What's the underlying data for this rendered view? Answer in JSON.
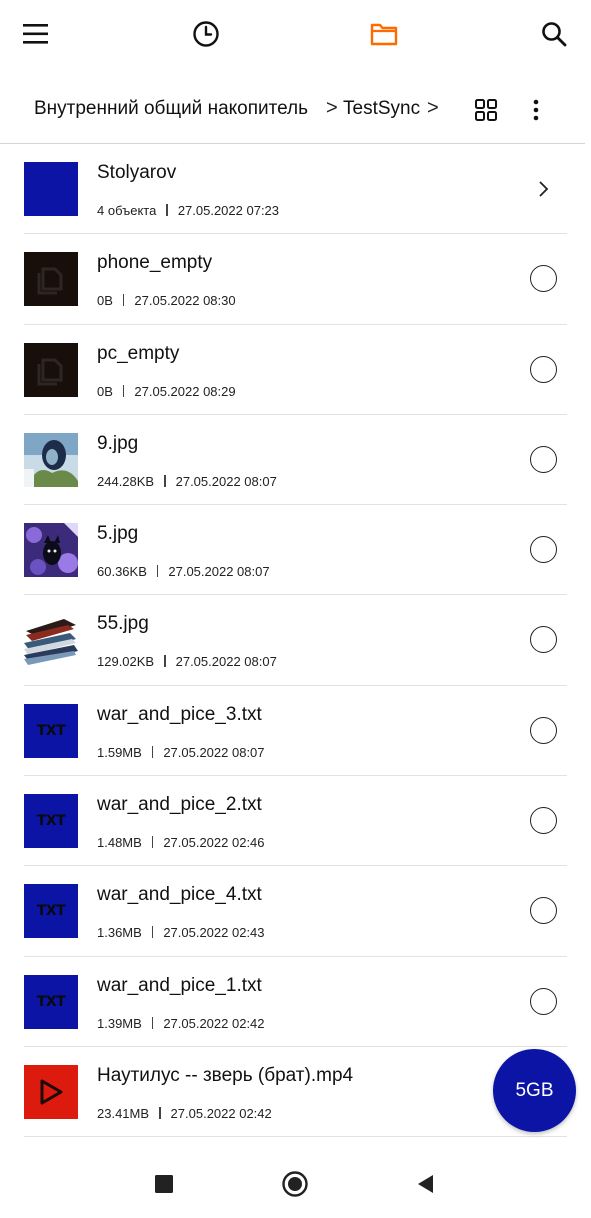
{
  "toolbar": {
    "icons": [
      "menu-icon",
      "clock-icon",
      "folder-icon",
      "search-icon"
    ],
    "accent_color": "#ff6a00"
  },
  "path": {
    "segments": [
      "Внутренний общий накопитель",
      "TestSync"
    ],
    "separator": ">",
    "icons": [
      "grid-view-icon",
      "more-vert-icon"
    ]
  },
  "files": [
    {
      "name": "Stolyarov",
      "size": "4 объекта",
      "date": "27.05.2022 07:23",
      "type": "folder"
    },
    {
      "name": "phone_empty",
      "size": "0B",
      "date": "27.05.2022 08:30",
      "type": "file"
    },
    {
      "name": "pc_empty",
      "size": "0B",
      "date": "27.05.2022 08:29",
      "type": "file"
    },
    {
      "name": "9.jpg",
      "size": "244.28KB",
      "date": "27.05.2022 08:07",
      "type": "image"
    },
    {
      "name": "5.jpg",
      "size": "60.36KB",
      "date": "27.05.2022 08:07",
      "type": "image"
    },
    {
      "name": "55.jpg",
      "size": "129.02KB",
      "date": "27.05.2022 08:07",
      "type": "image"
    },
    {
      "name": "war_and_pice_3.txt",
      "size": "1.59MB",
      "date": "27.05.2022 08:07",
      "type": "txt"
    },
    {
      "name": "war_and_pice_2.txt",
      "size": "1.48MB",
      "date": "27.05.2022 02:46",
      "type": "txt"
    },
    {
      "name": "war_and_pice_4.txt",
      "size": "1.36MB",
      "date": "27.05.2022 02:43",
      "type": "txt"
    },
    {
      "name": "war_and_pice_1.txt",
      "size": "1.39MB",
      "date": "27.05.2022 02:42",
      "type": "txt"
    },
    {
      "name": "Наутилус -- зверь (брат).mp4",
      "size": "23.41MB",
      "date": "27.05.2022 02:42",
      "type": "video"
    }
  ],
  "txt_icon_label": "TXT",
  "fab": {
    "label": "5GB",
    "color": "#0b14a4"
  },
  "navbar": {
    "icons": [
      "recent-apps-icon",
      "home-icon",
      "back-icon"
    ]
  }
}
